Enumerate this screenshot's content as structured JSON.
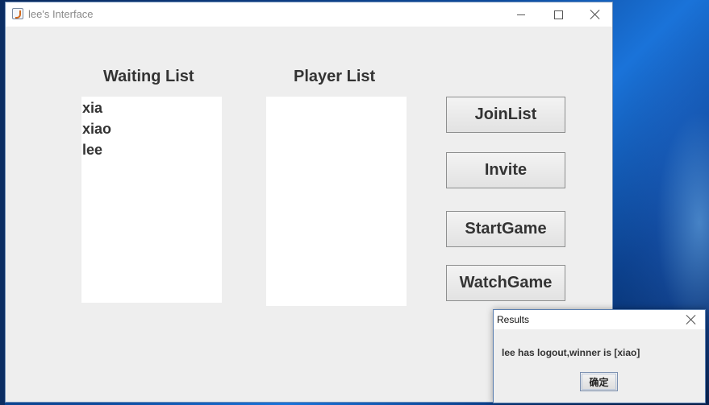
{
  "window": {
    "title": "lee's Interface"
  },
  "waiting_list": {
    "heading": "Waiting List",
    "items": [
      "xia",
      "xiao",
      "lee"
    ]
  },
  "player_list": {
    "heading": "Player List",
    "items": []
  },
  "buttons": {
    "join": "JoinList",
    "invite": "Invite",
    "start": "StartGame",
    "watch": "WatchGame"
  },
  "dialog": {
    "title": "Results",
    "message": "lee has logout,winner is [xiao]",
    "ok_label": "确定"
  },
  "icons": {
    "app": "java-app-icon",
    "minimize": "minimize-icon",
    "maximize": "maximize-icon",
    "close": "close-icon"
  }
}
